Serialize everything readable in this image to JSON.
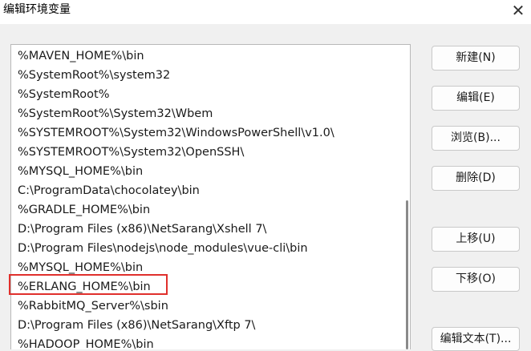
{
  "window": {
    "title": "编辑环境变量",
    "close_glyph": "✕"
  },
  "list": {
    "items": [
      "%MAVEN_HOME%\\bin",
      "%SystemRoot%\\system32",
      "%SystemRoot%",
      "%SystemRoot%\\System32\\Wbem",
      "%SYSTEMROOT%\\System32\\WindowsPowerShell\\v1.0\\",
      "%SYSTEMROOT%\\System32\\OpenSSH\\",
      "%MYSQL_HOME%\\bin",
      "C:\\ProgramData\\chocolatey\\bin",
      "%GRADLE_HOME%\\bin",
      "D:\\Program Files (x86)\\NetSarang\\Xshell 7\\",
      "D:\\Program Files\\nodejs\\node_modules\\vue-cli\\bin",
      "%MYSQL_HOME%\\bin",
      "%ERLANG_HOME%\\bin",
      "%RabbitMQ_Server%\\sbin",
      "D:\\Program Files (x86)\\NetSarang\\Xftp 7\\",
      "%HADOOP_HOME%\\bin"
    ],
    "highlighted_item": "%ERLANG_HOME%\\bin",
    "highlight_color": "#e0302c"
  },
  "buttons": {
    "new": "新建(N)",
    "edit": "编辑(E)",
    "browse": "浏览(B)...",
    "delete": "删除(D)",
    "move_up": "上移(U)",
    "move_down": "下移(O)",
    "edit_text": "编辑文本(T)..."
  }
}
